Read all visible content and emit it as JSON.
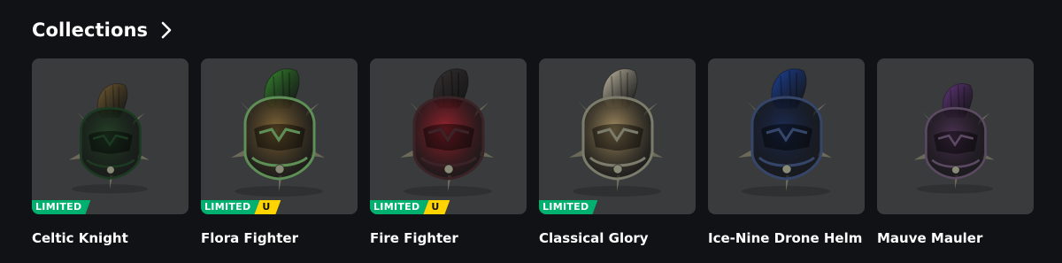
{
  "header": {
    "title": "Collections",
    "chevron_icon": "chevron-right-icon"
  },
  "items": [
    {
      "name": "Celtic Knight",
      "badges": [
        "LIMITED"
      ],
      "colors": {
        "crest": "#7a6236",
        "shell": "#27452a",
        "trim": "#1c3a22"
      }
    },
    {
      "name": "Flora Fighter",
      "badges": [
        "LIMITED",
        "U"
      ],
      "colors": {
        "crest": "#3b8f33",
        "shell": "#866a3a",
        "trim": "#5e8f56"
      }
    },
    {
      "name": "Fire Fighter",
      "badges": [
        "LIMITED",
        "U"
      ],
      "colors": {
        "crest": "#3a3434",
        "shell": "#9a2530",
        "trim": "#3b2427"
      }
    },
    {
      "name": "Classical Glory",
      "badges": [
        "LIMITED"
      ],
      "colors": {
        "crest": "#cfc7b0",
        "shell": "#a68f63",
        "trim": "#7c7c6c"
      }
    },
    {
      "name": "Ice-Nine Drone Helm",
      "badges": [],
      "colors": {
        "crest": "#1f46a2",
        "shell": "#1d2d55",
        "trim": "#35466a"
      }
    },
    {
      "name": "Mauve Mauler",
      "badges": [],
      "colors": {
        "crest": "#6a3a86",
        "shell": "#4e3455",
        "trim": "#5c4a63"
      }
    }
  ]
}
